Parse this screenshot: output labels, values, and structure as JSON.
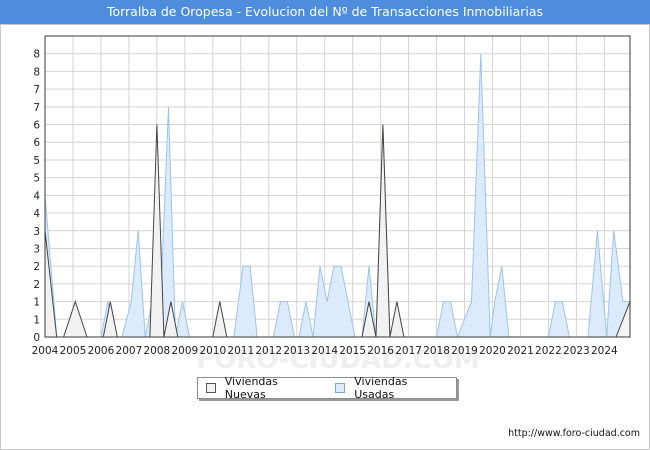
{
  "title": "Torralba de Oropesa - Evolucion del Nº de Transacciones Inmobiliarias",
  "footer": "http://www.foro-ciudad.com",
  "watermark": "FORO-CIUDAD.COM",
  "colors": {
    "title_bg": "#4e8ddc",
    "nuevas_fill": "#f2f2f2",
    "nuevas_line": "#444444",
    "usadas_fill": "#dcebfc",
    "usadas_line": "#9cc3ee",
    "grid": "#d4d4d4"
  },
  "chart_data": {
    "type": "area",
    "title": "Torralba de Oropesa - Evolucion del Nº de Transacciones Inmobiliarias",
    "x_start": "2004-01",
    "x_end": "2024-12",
    "x_tick_labels": [
      "2004",
      "2005",
      "2006",
      "2007",
      "2008",
      "2009",
      "2010",
      "2011",
      "2012",
      "2013",
      "2014",
      "2015",
      "2016",
      "2017",
      "2018",
      "2019",
      "2020",
      "2021",
      "2022",
      "2023",
      "2024"
    ],
    "y_tick_labels": [
      "0",
      "1",
      "1",
      "2",
      "2",
      "3",
      "3",
      "4",
      "4",
      "5",
      "5",
      "6",
      "6",
      "7",
      "7",
      "8",
      "8"
    ],
    "ylim": [
      0,
      8.5
    ],
    "grid": true,
    "legend_position": "bottom",
    "series": [
      {
        "name": "Viviendas Nuevas",
        "color": "#444444",
        "points": [
          [
            "2004-01",
            3
          ],
          [
            "2004-06",
            0
          ],
          [
            "2004-09",
            0
          ],
          [
            "2005-02",
            1
          ],
          [
            "2005-07",
            0
          ],
          [
            "2006-02",
            0
          ],
          [
            "2006-05",
            1
          ],
          [
            "2006-08",
            0
          ],
          [
            "2007-10",
            0
          ],
          [
            "2008-01",
            6
          ],
          [
            "2008-04",
            0
          ],
          [
            "2008-07",
            1
          ],
          [
            "2008-10",
            0
          ],
          [
            "2010-01",
            0
          ],
          [
            "2010-04",
            1
          ],
          [
            "2010-07",
            0
          ],
          [
            "2015-05",
            0
          ],
          [
            "2015-08",
            1
          ],
          [
            "2015-11",
            0
          ],
          [
            "2016-02",
            6
          ],
          [
            "2016-05",
            0
          ],
          [
            "2016-08",
            1
          ],
          [
            "2016-11",
            0
          ],
          [
            "2024-06",
            0
          ],
          [
            "2024-12",
            1
          ]
        ]
      },
      {
        "name": "Viviendas Usadas",
        "color": "#9cc3ee",
        "points": [
          [
            "2004-01",
            4
          ],
          [
            "2004-06",
            0
          ],
          [
            "2004-11",
            0
          ],
          [
            "2005-02",
            1
          ],
          [
            "2005-05",
            0
          ],
          [
            "2006-01",
            0
          ],
          [
            "2006-04",
            1
          ],
          [
            "2006-07",
            0
          ],
          [
            "2006-10",
            0
          ],
          [
            "2007-02",
            1
          ],
          [
            "2007-05",
            3
          ],
          [
            "2007-08",
            0
          ],
          [
            "2007-11",
            1
          ],
          [
            "2008-02",
            0
          ],
          [
            "2008-06",
            6.5
          ],
          [
            "2008-09",
            0
          ],
          [
            "2008-12",
            1
          ],
          [
            "2009-03",
            0
          ],
          [
            "2010-10",
            0
          ],
          [
            "2011-02",
            2
          ],
          [
            "2011-05",
            2
          ],
          [
            "2011-08",
            0
          ],
          [
            "2012-03",
            0
          ],
          [
            "2012-06",
            1
          ],
          [
            "2012-09",
            1
          ],
          [
            "2012-12",
            0
          ],
          [
            "2013-02",
            0
          ],
          [
            "2013-05",
            1
          ],
          [
            "2013-08",
            0
          ],
          [
            "2013-11",
            2
          ],
          [
            "2014-02",
            1
          ],
          [
            "2014-05",
            2
          ],
          [
            "2014-08",
            2
          ],
          [
            "2014-11",
            1
          ],
          [
            "2015-02",
            0
          ],
          [
            "2015-05",
            0
          ],
          [
            "2015-08",
            2
          ],
          [
            "2015-11",
            0
          ],
          [
            "2016-02",
            6
          ],
          [
            "2016-05",
            0
          ],
          [
            "2018-01",
            0
          ],
          [
            "2018-04",
            1
          ],
          [
            "2018-07",
            1
          ],
          [
            "2018-10",
            0
          ],
          [
            "2019-04",
            1
          ],
          [
            "2019-08",
            8
          ],
          [
            "2019-12",
            0
          ],
          [
            "2020-02",
            1
          ],
          [
            "2020-05",
            2
          ],
          [
            "2020-08",
            0
          ],
          [
            "2022-01",
            0
          ],
          [
            "2022-04",
            1
          ],
          [
            "2022-07",
            1
          ],
          [
            "2022-10",
            0
          ],
          [
            "2023-06",
            0
          ],
          [
            "2023-10",
            3
          ],
          [
            "2024-02",
            0
          ],
          [
            "2024-05",
            3
          ],
          [
            "2024-09",
            1
          ],
          [
            "2024-12",
            1
          ]
        ]
      }
    ]
  }
}
